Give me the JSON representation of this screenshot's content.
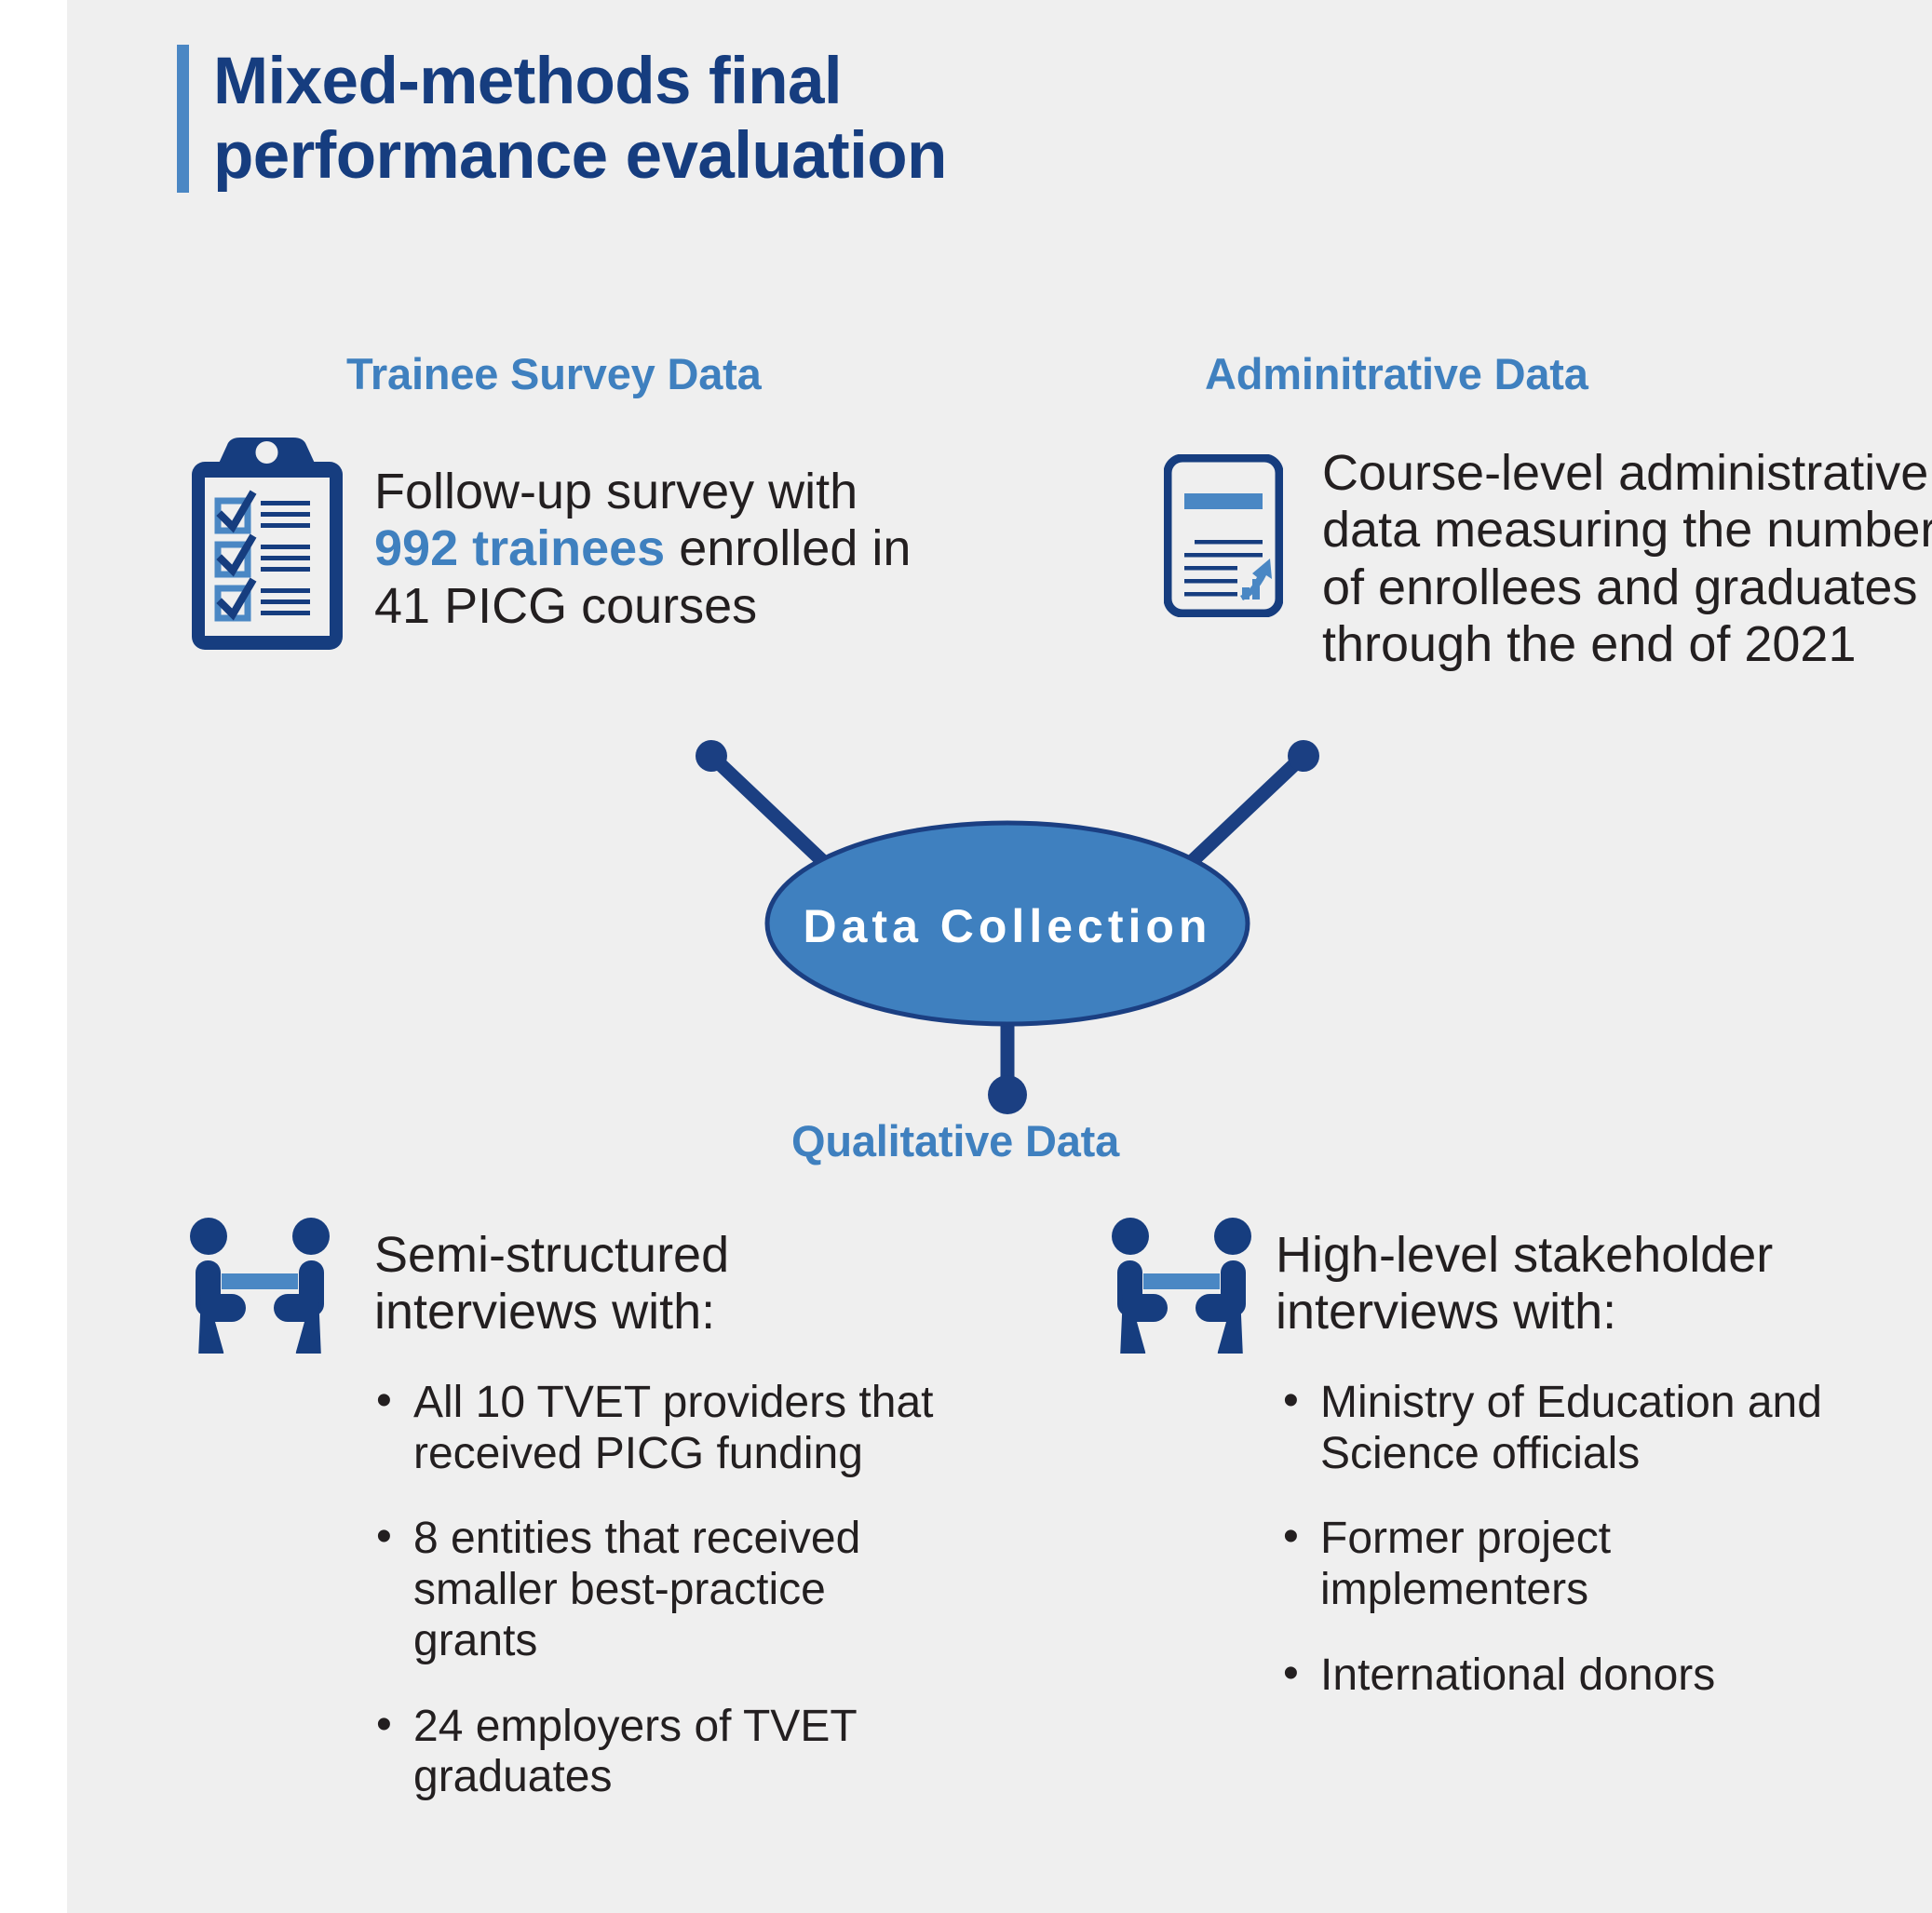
{
  "title": "Mixed-methods final\nperformance evaluation",
  "colors": {
    "navy": "#163d7f",
    "accent_blue": "#3f80bf",
    "ellipse_fill": "#3f80bf",
    "ellipse_stroke": "#1b3f82",
    "panel_bg": "#efefef",
    "body_text": "#231f20"
  },
  "center_node": {
    "label": "Data Collection"
  },
  "sections": {
    "trainee": {
      "heading": "Trainee Survey Data",
      "icon": "clipboard-checklist-icon",
      "text_before": "Follow-up survey with ",
      "highlight": "992 trainees",
      "text_after": " enrolled in 41 PICG courses"
    },
    "administrative": {
      "heading": "Adminitrative Data",
      "icon": "document-chart-icon",
      "text": "Course-level administrative data measuring the number of enrollees and graduates through the end of 2021"
    },
    "qualitative": {
      "heading": "Qualitative Data",
      "left": {
        "icon": "interview-two-people-icon",
        "intro": "Semi-structured interviews with:",
        "bullets": [
          "All 10 TVET providers that received PICG funding",
          "8 entities that received smaller best-practice grants",
          "24 employers of TVET graduates"
        ]
      },
      "right": {
        "icon": "interview-two-people-icon",
        "intro": "High-level stakeholder interviews with:",
        "bullets": [
          "Ministry of Education and Science officials",
          " Former project implementers",
          "International donors"
        ]
      }
    }
  }
}
